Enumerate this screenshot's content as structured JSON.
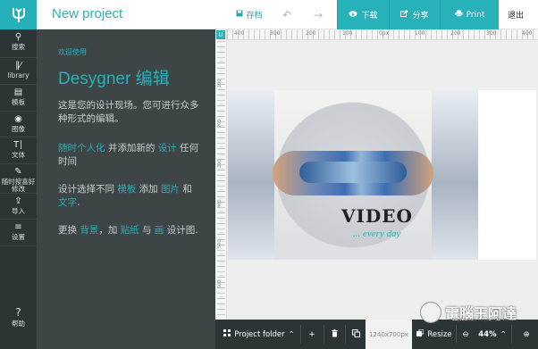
{
  "app": {
    "title": "New project",
    "logo_icon": "designer-logo-icon",
    "accent": "#27b1b9",
    "sidebar_color": "#2d3436",
    "panel_color": "#3d4547"
  },
  "toolbar": {
    "save_label": "存档",
    "undo_icon": "undo-arrow-icon",
    "redo_icon": "redo-arrow-icon",
    "download_label": "下载",
    "share_label": "分享",
    "print_label": "Print",
    "exit_label": "退出"
  },
  "sidebar": {
    "items": [
      {
        "icon": "search-icon",
        "label": "搜索"
      },
      {
        "icon": "library-icon",
        "label": "library"
      },
      {
        "icon": "template-icon",
        "label": "模板"
      },
      {
        "icon": "camera-icon",
        "label": "图像"
      },
      {
        "icon": "text-icon",
        "label": "文体"
      },
      {
        "icon": "pen-icon",
        "label": "随时按喜好修改"
      },
      {
        "icon": "upload-icon",
        "label": "导入"
      },
      {
        "icon": "settings-sliders-icon",
        "label": "设置"
      }
    ],
    "help": {
      "icon": "question-icon",
      "label": "帮助"
    }
  },
  "panel": {
    "welcome": "欢迎使用",
    "heading": "Desygner 编辑",
    "p1": "这是您的设计现场。您可进行众多种形式的编辑。",
    "p2": {
      "a": "随时个人化",
      "b": " 并添加新的 ",
      "c": "设计",
      "d": " 任何时间"
    },
    "p3": {
      "a": "设计选择不同 ",
      "b": "模板",
      "c": " 添加 ",
      "d": "图片",
      "e": " 和 ",
      "f": "文字",
      "g": "."
    },
    "p4": {
      "a": "更换 ",
      "b": "背景",
      "c": "，加 ",
      "d": "贴纸",
      "e": " 与 ",
      "f": "画",
      "g": " 设计图."
    }
  },
  "ruler": {
    "corner": "U",
    "top_labels": [
      "400",
      "300",
      "200",
      "100",
      "0px",
      "100",
      "200",
      "300",
      "400"
    ],
    "side_labels": [
      "100",
      "200",
      "300",
      "400",
      "500",
      "600",
      "700"
    ]
  },
  "design": {
    "title": "VIDEO",
    "subtitle": "... every day"
  },
  "bottombar": {
    "folder_label": "Project folder",
    "folder_icon": "folder-icon",
    "add_icon": "plus-icon",
    "trash_icon": "trash-icon",
    "copy_icon": "copy-icon",
    "size_label": "1240x700px",
    "resize_label": "Resize",
    "zoom_label": "44%",
    "zoom_out_icon": "zoom-out-icon",
    "zoom_in_icon": "zoom-in-icon"
  },
  "watermark": {
    "text": "電腦王阿達",
    "small": "http://www.kocpc.com.tw"
  }
}
